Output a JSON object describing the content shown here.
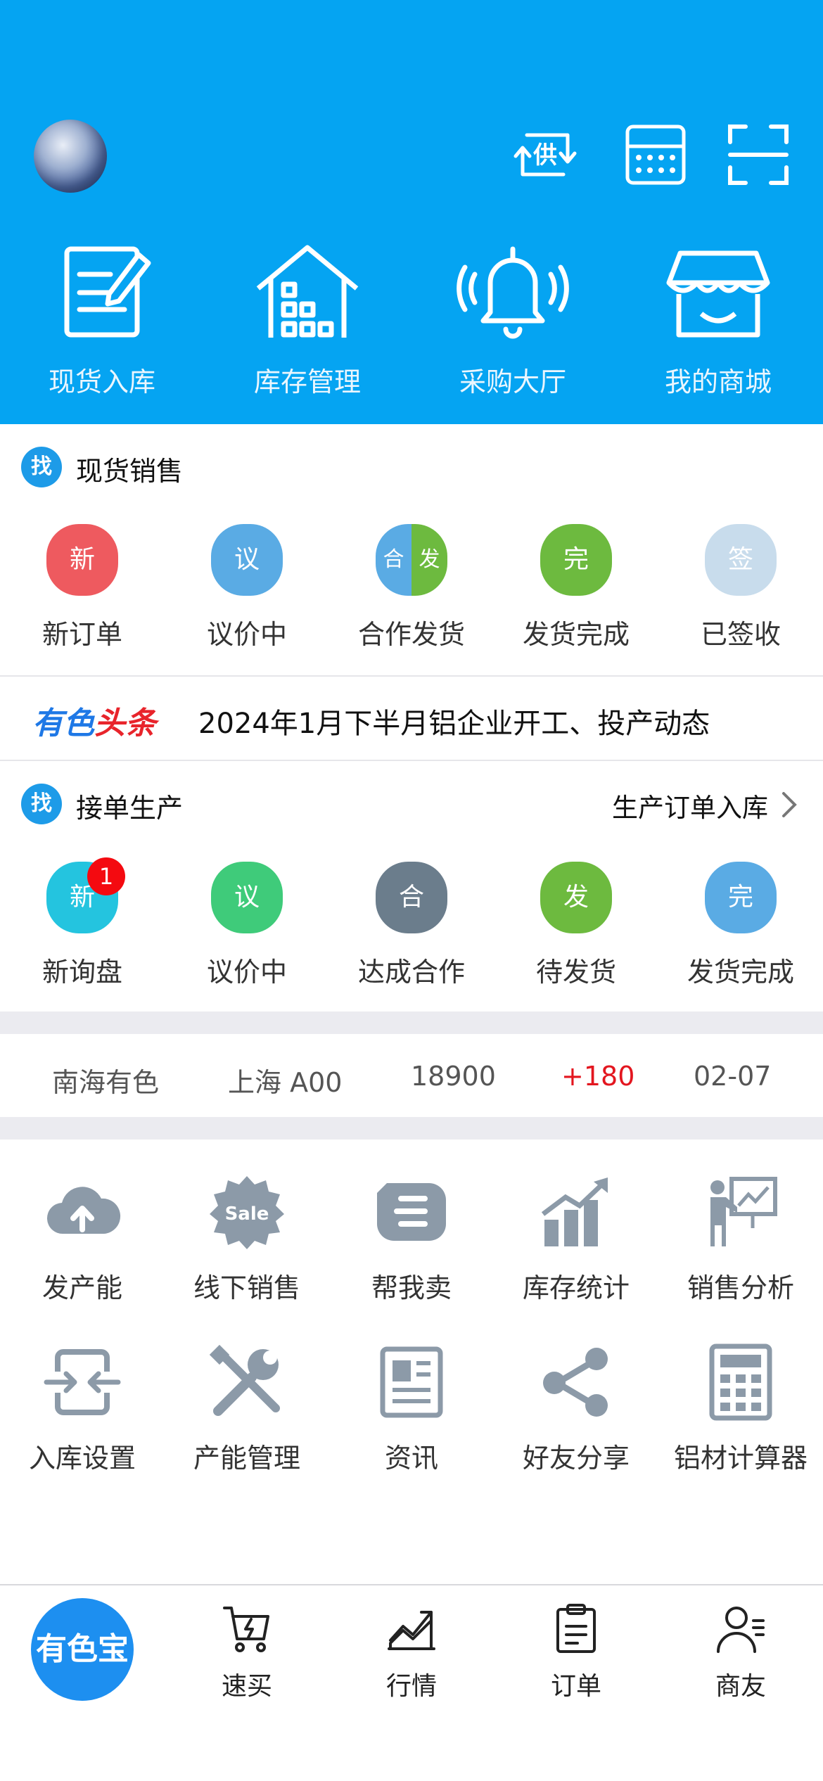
{
  "header": {
    "top_icons": [
      "supply-switch-icon",
      "calculator-icon",
      "scan-icon"
    ],
    "supply_icon_text": "供",
    "quick_actions": [
      {
        "label": "现货入库",
        "icon": "edit-document-icon"
      },
      {
        "label": "库存管理",
        "icon": "warehouse-icon"
      },
      {
        "label": "采购大厅",
        "icon": "bell-icon"
      },
      {
        "label": "我的商城",
        "icon": "shop-icon"
      }
    ]
  },
  "spot_sales": {
    "badge": "找",
    "title": "现货销售",
    "items": [
      {
        "glyph": "新",
        "label": "新订单",
        "color": "#ee5a5f"
      },
      {
        "glyph": "议",
        "label": "议价中",
        "color": "#5aabe4"
      },
      {
        "glyph_left": "合",
        "glyph_right": "发",
        "label": "合作发货",
        "color_left": "#5aabe4",
        "color_right": "#6dba3f"
      },
      {
        "glyph": "完",
        "label": "发货完成",
        "color": "#6dba3f"
      },
      {
        "glyph": "签",
        "label": "已签收",
        "color": "#c8dcec"
      }
    ]
  },
  "news": {
    "brand_part1": "有色",
    "brand_part2": "头条",
    "headline": "2024年1月下半月铝企业开工、投产动态"
  },
  "production": {
    "badge": "找",
    "title": "接单生产",
    "link": "生产订单入库",
    "items": [
      {
        "glyph": "新",
        "label": "新询盘",
        "color": "#24c4df",
        "badge": "1"
      },
      {
        "glyph": "议",
        "label": "议价中",
        "color": "#3fcb7a"
      },
      {
        "glyph": "合",
        "label": "达成合作",
        "color": "#6b7d8c"
      },
      {
        "glyph": "发",
        "label": "待发货",
        "color": "#6dba3f"
      },
      {
        "glyph": "完",
        "label": "发货完成",
        "color": "#5aabe4"
      }
    ]
  },
  "ticker": {
    "source": "南海有色",
    "market": "上海 A00",
    "price": "18900",
    "change": "+180",
    "date": "02-07"
  },
  "tools": [
    {
      "label": "发产能",
      "icon": "cloud-upload-icon"
    },
    {
      "label": "线下销售",
      "icon": "sale-badge-icon",
      "icon_text": "Sale"
    },
    {
      "label": "帮我卖",
      "icon": "help-sell-icon"
    },
    {
      "label": "库存统计",
      "icon": "bar-chart-icon"
    },
    {
      "label": "销售分析",
      "icon": "presentation-icon"
    },
    {
      "label": "入库设置",
      "icon": "compress-icon"
    },
    {
      "label": "产能管理",
      "icon": "tools-icon"
    },
    {
      "label": "资讯",
      "icon": "newspaper-icon"
    },
    {
      "label": "好友分享",
      "icon": "share-icon"
    },
    {
      "label": "铝材计算器",
      "icon": "calculator-icon"
    }
  ],
  "tabbar": {
    "home": "有色宝",
    "tabs": [
      {
        "label": "速买",
        "icon": "cart-icon"
      },
      {
        "label": "行情",
        "icon": "trend-chart-icon"
      },
      {
        "label": "订单",
        "icon": "clipboard-icon"
      },
      {
        "label": "商友",
        "icon": "contacts-icon"
      }
    ]
  },
  "colors": {
    "header_bg": "#05a4f2",
    "accent": "#1d8ff0",
    "price_up": "#e3161f",
    "icon_gray": "#8c9aa8"
  }
}
